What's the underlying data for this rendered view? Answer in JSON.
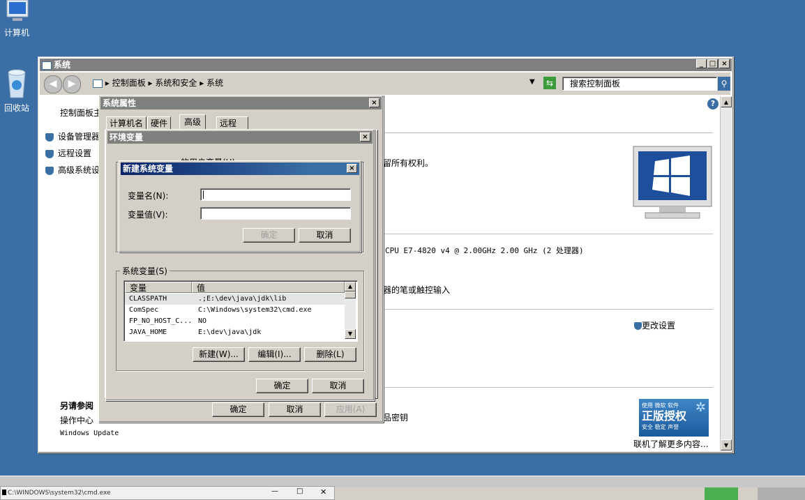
{
  "desktop": {
    "icons": [
      {
        "label": "计算机"
      },
      {
        "label": "回收站"
      }
    ]
  },
  "system_window": {
    "title": "系统",
    "address": {
      "root": "控制面板",
      "crumb1": "系统和安全",
      "crumb2": "系统"
    },
    "search_placeholder": "搜索控制面板",
    "left_nav": {
      "home": "控制面板主",
      "items": [
        "设备管理器",
        "远程设置",
        "高级系统设"
      ]
    },
    "see_also": {
      "title": "另请参阅",
      "items": [
        "操作中心",
        "Windows Update"
      ]
    },
    "content": {
      "rights": "留所有权利。",
      "cpu": "CPU E7-4820 v4 @ 2.00GHz   2.00 GHz  (2 处理器)",
      "pen": "器的笔或触控输入",
      "change_settings": "更改设置",
      "product_key": "品密钥",
      "genuine_top": "使用 微软 软件",
      "genuine_main": "正版授权",
      "genuine_sub": "安全 稳定 声誉",
      "more_online": "联机了解更多内容..."
    }
  },
  "sysprops": {
    "title": "系统属性",
    "tabs": [
      "计算机名",
      "硬件",
      "高级",
      "远程"
    ],
    "buttons": {
      "ok": "确定",
      "cancel": "取消",
      "apply": "应用(A)"
    }
  },
  "envvars": {
    "title": "环境变量",
    "user_section_partial": "的用户变量(U)",
    "system_section": "系统变量(S)",
    "columns": [
      "变量",
      "值"
    ],
    "rows": [
      {
        "name": "CLASSPATH",
        "value": ".;E:\\dev\\java\\jdk\\lib"
      },
      {
        "name": "ComSpec",
        "value": "C:\\Windows\\system32\\cmd.exe"
      },
      {
        "name": "FP_NO_HOST_C...",
        "value": "NO"
      },
      {
        "name": "JAVA_HOME",
        "value": "E:\\dev\\java\\jdk"
      }
    ],
    "buttons": {
      "new": "新建(W)...",
      "edit": "编辑(I)...",
      "delete": "删除(L)",
      "ok": "确定",
      "cancel": "取消"
    }
  },
  "newvar": {
    "title": "新建系统变量",
    "name_label": "变量名(N):",
    "value_label": "变量值(V):",
    "name_value": "",
    "value_value": "",
    "ok": "确定",
    "cancel": "取消"
  },
  "taskbar": {
    "cmd_title": "C:\\WINDOWS\\system32\\cmd.exe"
  }
}
